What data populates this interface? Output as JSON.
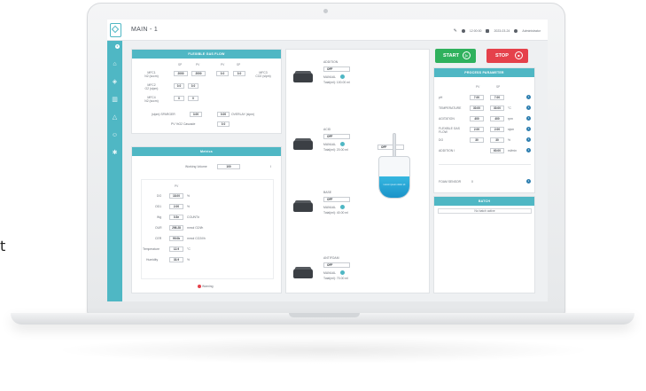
{
  "page_edge_text": "t",
  "topbar": {
    "title": "MAIN - 1",
    "time": "12:00:00",
    "date": "2023-03-24",
    "user": "Administrator"
  },
  "sidebar": {
    "badge": "0",
    "icons": [
      "home-icon",
      "layers-icon",
      "bar-chart-icon",
      "flask-icon",
      "user-icon",
      "gear-icon"
    ]
  },
  "flexible_gas": {
    "title": "FLEXIBLE GAS FLOW",
    "col_sp": "SP",
    "col_pv": "PV",
    "col_pv2": "PV",
    "col_sp2": "SP",
    "rows": [
      {
        "label": "MFC1",
        "sub": "N2 (sccm)",
        "sp": "2000",
        "pv": "2000",
        "pv2": "0.0",
        "sp2": "0.0",
        "right": "MFC3",
        "right_sub": "CO2 (slpm)"
      },
      {
        "label": "MFC2",
        "sub": "O2 (slpm)",
        "sp": "0.0",
        "pv": "0.0"
      },
      {
        "label": "MFC4",
        "sub": "N2 (sccm)",
        "sp": "0",
        "pv": "0"
      }
    ],
    "sparger_label": "(slpm) SPARGER",
    "sparger_val": "3.00",
    "sparger_val2": "0.00",
    "overlay_label": "OVERLAY (slpm)",
    "cascade_label": "PV %O2 Cascade",
    "cascade_val": "0.0"
  },
  "metrics": {
    "title": "Metrics",
    "working_volume_label": "Working Volume",
    "working_volume": "100",
    "pv_header": "PV",
    "rows": [
      {
        "label": "DO",
        "value": "18.00",
        "unit": "%"
      },
      {
        "label": "OD1",
        "value": "2.00",
        "unit": "%"
      },
      {
        "label": "Wg",
        "value": "0.5e",
        "unit": "COUNT#"
      },
      {
        "label": "OUR",
        "value": "298.28",
        "unit": "mmol O2/l/h"
      },
      {
        "label": "CER",
        "value": "99.0b",
        "unit": "mmol CO2/l/h"
      },
      {
        "label": "Temperature",
        "value": "12.9",
        "unit": "°C"
      },
      {
        "label": "Humidity",
        "value": "33.9",
        "unit": "%"
      }
    ],
    "warning": "Warning"
  },
  "pumps": [
    {
      "name": "ADDITION",
      "state": "OFF",
      "mode": "MANUAL",
      "total": "Total(ml): 100.00 ml"
    },
    {
      "name": "ACID",
      "state": "OFF",
      "mode": "MANUAL",
      "total": "Total(ml): 20.00 ml"
    },
    {
      "name": "BASE",
      "state": "OFF",
      "mode": "MANUAL",
      "total": "Total(ml): 40.00 ml"
    },
    {
      "name": "ANTIFOAM",
      "state": "OFF",
      "mode": "MANUAL",
      "total": "Total(ml): 70.00 ml"
    }
  ],
  "vessel": {
    "selector": "OFF",
    "inner_text": "Lorem ipsum dolor sit"
  },
  "controls": {
    "start": "START",
    "stop": "STOP"
  },
  "process": {
    "title": "PROCESS PARAMETER",
    "col_pv": "PV",
    "col_sp": "SP",
    "rows": [
      {
        "label": "pH",
        "pv": "7.00",
        "sp": "7.00",
        "unit": ""
      },
      {
        "label": "TEMPERATURE",
        "pv": "30.00",
        "sp": "30.00",
        "unit": "°C"
      },
      {
        "label": "AGITATION",
        "pv": "400",
        "sp": "400",
        "unit": "rpm"
      },
      {
        "label": "FLEXIBLE GAS FLOW",
        "pv": "2.00",
        "sp": "2.00",
        "unit": "slpm"
      },
      {
        "label": "DO",
        "pv": "30",
        "sp": "30",
        "unit": "%"
      },
      {
        "label": "ADDITION I",
        "pv": "",
        "sp": "60.00",
        "unit": "ml/min"
      }
    ],
    "foam_label": "FOAM SENSOR",
    "foam_value": "0"
  },
  "batch": {
    "title": "BATCH",
    "status": "No batch active"
  },
  "colors": {
    "accent": "#4fb7c4",
    "start": "#2fb15d",
    "stop": "#e5414b",
    "liquid": "#1b93c9"
  }
}
